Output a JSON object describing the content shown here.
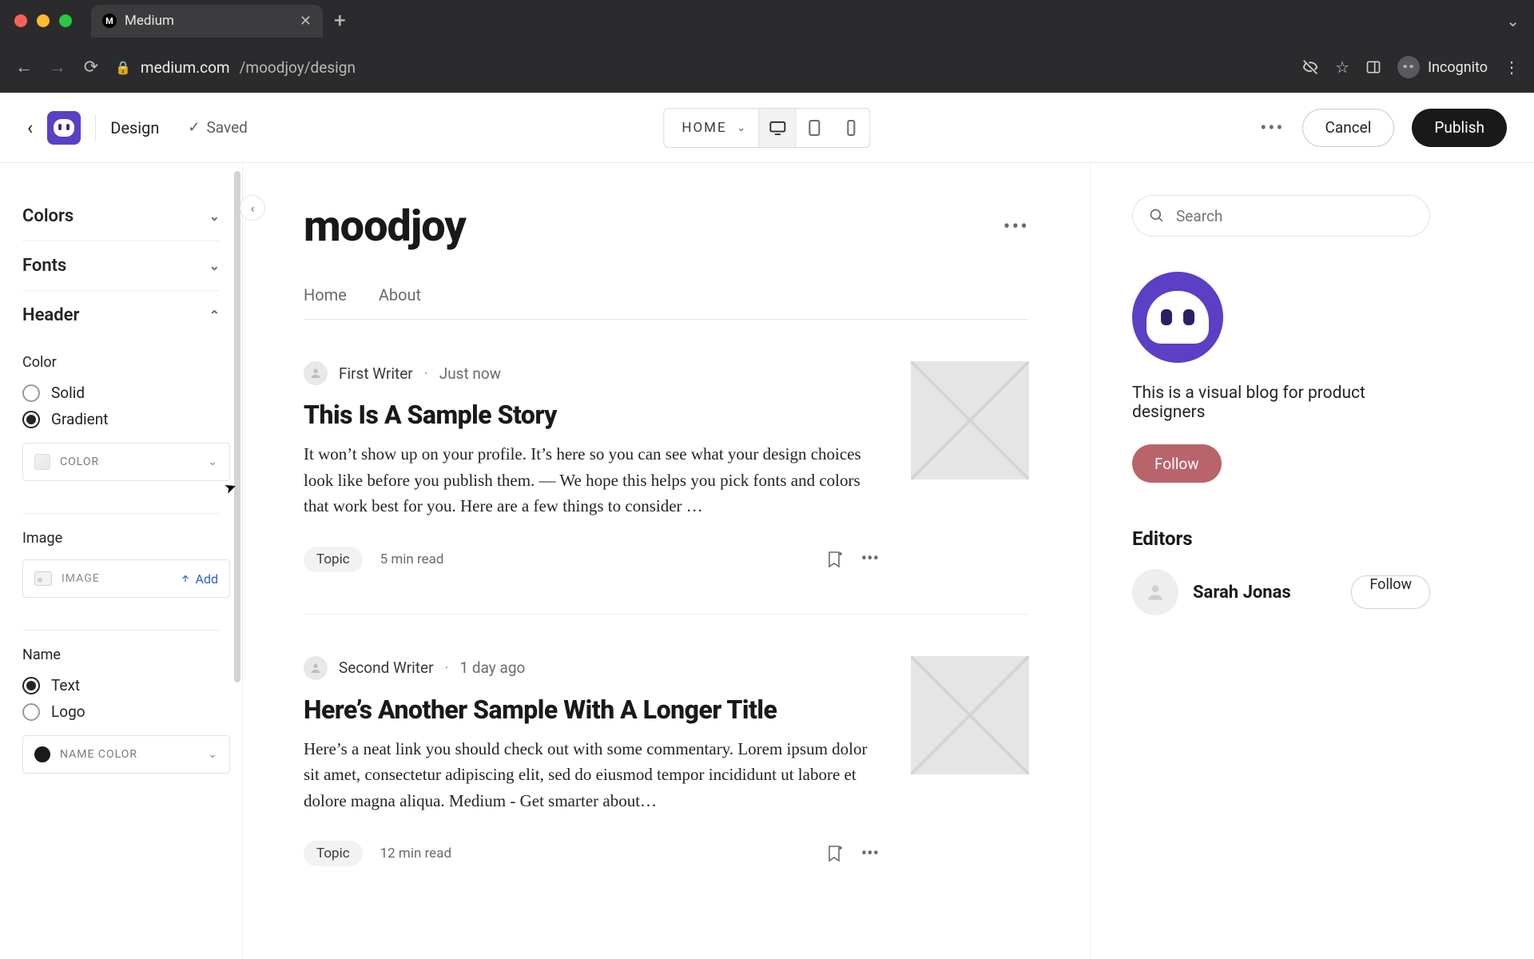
{
  "browser": {
    "tab_title": "Medium",
    "url_host": "medium.com",
    "url_path": "/moodjoy/design",
    "incognito_label": "Incognito"
  },
  "toolbar": {
    "design_label": "Design",
    "saved_label": "Saved",
    "page_selector": "HOME",
    "cancel": "Cancel",
    "publish": "Publish"
  },
  "sidebar": {
    "panel_colors": "Colors",
    "panel_fonts": "Fonts",
    "panel_header": "Header",
    "color_label": "Color",
    "color_opt_solid": "Solid",
    "color_opt_gradient": "Gradient",
    "color_picker_label": "COLOR",
    "image_label": "Image",
    "image_picker_label": "IMAGE",
    "image_add": "Add",
    "name_label": "Name",
    "name_opt_text": "Text",
    "name_opt_logo": "Logo",
    "name_color_label": "NAME COLOR"
  },
  "publication": {
    "title": "moodjoy",
    "nav_home": "Home",
    "nav_about": "About",
    "bio": "This is a visual blog for product designers",
    "follow": "Follow",
    "editors_heading": "Editors",
    "editor_name": "Sarah Jonas",
    "editor_follow": "Follow",
    "search_placeholder": "Search"
  },
  "stories": [
    {
      "author": "First Writer",
      "ago": "Just now",
      "title": "This Is A Sample Story",
      "body": "It won’t show up on your profile. It’s here so you can see what your design choices look like before you publish them. — We hope this helps you pick fonts and colors that work best for you. Here are a few things to consider …",
      "topic": "Topic",
      "read": "5 min read"
    },
    {
      "author": "Second Writer",
      "ago": "1 day ago",
      "title": "Here’s Another Sample With A Longer Title",
      "body": "Here’s a neat link you should check out with some commentary. Lorem ipsum dolor sit amet, consectetur adipiscing elit, sed do eiusmod tempor incididunt ut labore et dolore magna aliqua. Medium - Get smarter about…",
      "topic": "Topic",
      "read": "12 min read"
    }
  ]
}
